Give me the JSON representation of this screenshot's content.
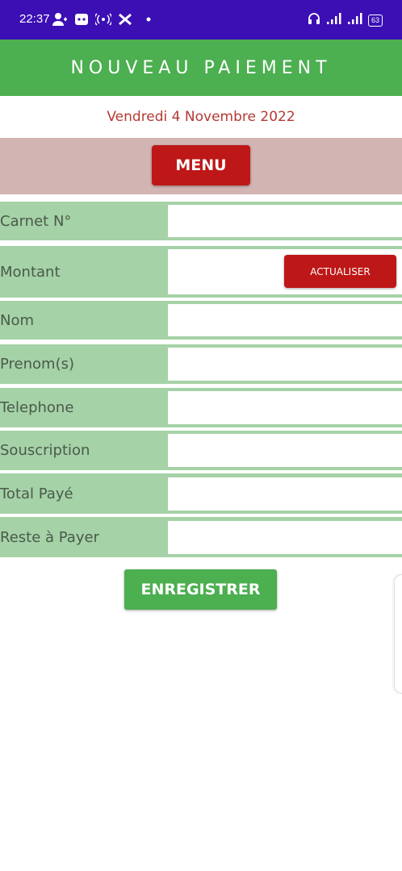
{
  "status_bar": {
    "time": "22:37",
    "battery": "63",
    "icons": [
      "person-add-icon",
      "gamepad-icon",
      "hotspot-icon",
      "x-icon",
      "dot-icon",
      "headset-icon",
      "signal-icon",
      "signal-icon",
      "battery-icon"
    ]
  },
  "header": {
    "title": "NOUVEAU PAIEMENT"
  },
  "date": "Vendredi 4 Novembre 2022",
  "menu": {
    "label": "MENU"
  },
  "form": {
    "rows": [
      {
        "label": "Carnet N°",
        "value": ""
      },
      {
        "label": "Montant",
        "value": ""
      },
      {
        "label": "Nom",
        "value": ""
      },
      {
        "label": "Prenom(s)",
        "value": ""
      },
      {
        "label": "Telephone",
        "value": ""
      },
      {
        "label": "Souscription",
        "value": ""
      },
      {
        "label": "Total Payé",
        "value": ""
      },
      {
        "label": "Reste à Payer",
        "value": ""
      }
    ],
    "refresh_label": "ACTUALISER",
    "save_label": "ENREGISTRER"
  },
  "colors": {
    "status_bar": "#3b0fb3",
    "header": "#4caf50",
    "date_text": "#b53a33",
    "menu_band": "#d2b4b3",
    "red_button": "#be1717",
    "label_bg": "#a5d2a7",
    "save_button": "#4caf50"
  }
}
